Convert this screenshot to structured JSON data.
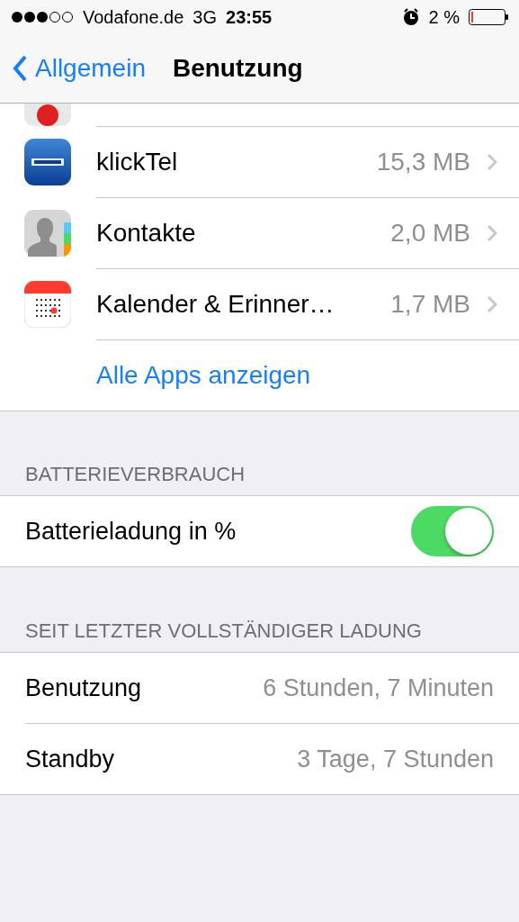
{
  "status_bar": {
    "carrier": "Vodafone.de",
    "network": "3G",
    "time": "23:55",
    "battery": "2 %"
  },
  "nav_bar": {
    "back": "Allgemein",
    "title": "Benutzung"
  },
  "apps": [
    {
      "kind": "klicktel",
      "name": "klickTel",
      "size": "15,3 MB"
    },
    {
      "kind": "contacts",
      "name": "Kontakte",
      "size": "2,0 MB"
    },
    {
      "kind": "calendar",
      "name": "Kalender & Erinner…",
      "size": "1,7 MB"
    }
  ],
  "show_all": "Alle Apps anzeigen",
  "battery_section": {
    "header": "BATTERIEVERBRAUCH",
    "label": "Batterieladung in %",
    "on": true
  },
  "since_section": {
    "header": "SEIT LETZTER VOLLSTÄNDIGER LADUNG",
    "rows": [
      {
        "label": "Benutzung",
        "value": "6 Stunden, 7 Minuten"
      },
      {
        "label": "Standby",
        "value": "3 Tage, 7 Stunden"
      }
    ]
  }
}
